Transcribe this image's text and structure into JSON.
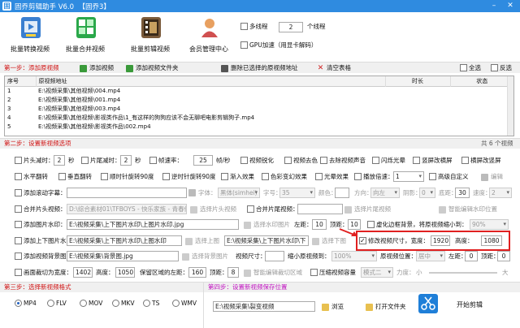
{
  "window": {
    "title": "固乔剪辑助手 V6.0",
    "edition": "【固乔3】",
    "logo": "固"
  },
  "toolbar": {
    "buttons": [
      {
        "label": "批量转换视频",
        "icon": "film-convert-icon",
        "color": "#3a7fd0"
      },
      {
        "label": "批量合并视频",
        "icon": "merge-blocks-icon",
        "color": "#2aa84a"
      },
      {
        "label": "批量剪辑视频",
        "icon": "film-strip-icon",
        "color": "#7a5a3a"
      },
      {
        "label": "会员管理中心",
        "icon": "user-icon",
        "color": "#d08030"
      }
    ],
    "multithread_label": "多线程",
    "thread_count": "2",
    "thread_unit": "个线程",
    "gpu_label": "GPU加速（用显卡解码）"
  },
  "step1": {
    "title": "第一步：添加原视频",
    "add_video": "添加视频",
    "add_folder": "添加视频文件夹",
    "delete_selected": "删除已选择的原视频地址",
    "clear_table": "清空表格",
    "select_all": "全选",
    "invert": "反选"
  },
  "table": {
    "headers": [
      "序号",
      "原视频地址",
      "时长",
      "状态"
    ],
    "rows": [
      [
        "1",
        "E:\\视频采集\\其他视频\\004.mp4",
        "",
        ""
      ],
      [
        "2",
        "E:\\视频采集\\其他视频\\001.mp4",
        "",
        ""
      ],
      [
        "3",
        "E:\\视频采集\\其他视频\\003.mp4",
        "",
        ""
      ],
      [
        "4",
        "E:\\视频采集\\其他视频\\影视类作品\\1_有这样的狗狗应该不会无聊吧电影剪辑狗子.mp4",
        "",
        ""
      ],
      [
        "5",
        "E:\\视频采集\\其他视频\\影视类作品\\002.mp4",
        "",
        ""
      ]
    ],
    "total": "共 6 个视频"
  },
  "step2": {
    "title": "第二步：设置新视频选项",
    "row1": {
      "cut_head": "片头减时：",
      "cut_head_val": "2",
      "sec1": "秒",
      "cut_tail": "片尾减时：",
      "cut_tail_val": "2",
      "sec2": "秒",
      "fps": "帧速率：",
      "fps_val": "25",
      "fps_unit": "帧/秒",
      "sharpen": "视频锐化",
      "decolor": "视频去色",
      "remove_audio": "去除视频声音",
      "flash": "闪烁光晕",
      "hmirror": "竖屏改横屏",
      "hpad": "横屏改竖屏"
    },
    "row2": {
      "hflip": "水平翻转",
      "vflip": "垂直翻转",
      "rot90cw": "顺时针旋转90度",
      "rot90ccw": "逆时针旋转90度",
      "fadein": "渐入效果",
      "color_effect": "色彩变幻效果",
      "light_effect": "光晕效果",
      "speed_label": "播放倍速：",
      "speed_val": "1",
      "advanced": "高级自定义",
      "edit": "编辑"
    },
    "row3": {
      "scroll_text": "添加滚动字幕：",
      "font": "字体：",
      "font_val": "黑体(simhei)",
      "size": "字号：",
      "size_val": "35",
      "color": "颜色：",
      "dir": "方向：",
      "dir_val": "向左",
      "shadow": "阴影：",
      "shadow_val": "0",
      "bottom": "底距：",
      "bottom_val": "30",
      "speed": "速度：",
      "speed_val": "2"
    },
    "row4": {
      "merge_head": "合并片头视频：",
      "head_path": "D:\\综合素材01\\TFBOYS - 快乐家族 - 青春修",
      "choose_head": "选择片头视频",
      "merge_tail": "合并片尾视频：",
      "tail_path": "选择片尾视频",
      "smart": "智能编辑水印位置"
    },
    "row5": {
      "watermark": "添加图片水印：",
      "wm_path": "E:\\视频采集\\上下图片水印\\上图片水印.jpg",
      "choose_wm": "选择水印图片",
      "left": "左距：",
      "left_val": "10",
      "top": "顶距：",
      "top_val": "10",
      "blur": "虚化边框背景，将原视频缩小到：",
      "blur_val": "90%"
    },
    "row6": {
      "topbottom": "添加上下图片水印：",
      "top_path": "E:\\视频采集\\上下图片水印\\上图水印",
      "choose_top": "选择上图",
      "bottom_path": "E:\\视频采集\\上下图片水印\\下",
      "choose_bottom": "选择下图",
      "modify_size": "修改视频尺寸，宽度：",
      "width_val": "1920",
      "height": "高度：",
      "height_val": "1080"
    },
    "row7": {
      "bg": "添加视频背景图片：",
      "bg_path": "E:\\视频采集\\背景图.jpg",
      "choose_bg": "选择背景图片",
      "video_size": "视频尺寸：",
      "shrink": "缩小原视频到：",
      "shrink_val": "100%",
      "pos": "原视频位置：",
      "pos_val": "居中",
      "left": "左距：",
      "left_val": "0",
      "top": "顶距：",
      "top_val": "0"
    },
    "row8": {
      "crop": "画面裁切为宽度：",
      "crop_w": "1402",
      "height": "高度：",
      "crop_h": "1050",
      "keep": "保留区域的左距：",
      "keep_left": "160",
      "top": "顶距：",
      "keep_top": "8",
      "smart_crop": "智能编辑裁切区域",
      "compress": "压缩视频容量",
      "mode": "模式二",
      "strength": "力度：",
      "small": "小",
      "big": "大"
    }
  },
  "step3": {
    "title": "第三步：选择新视频格式",
    "formats": [
      "MP4",
      "FLV",
      "MOV",
      "MKV",
      "TS",
      "WMV"
    ],
    "selected": "MP4"
  },
  "step4": {
    "title": "第四步：设置新视频保存位置",
    "path": "E:\\视频采集\\裂变视频",
    "browse": "浏览",
    "open_folder": "打开文件夹",
    "start": "开始剪辑"
  },
  "colors": {
    "titlebar": "#2f8be0",
    "step_title": "#d01010",
    "step4": "#c010c0",
    "highlight": "#e02020"
  }
}
